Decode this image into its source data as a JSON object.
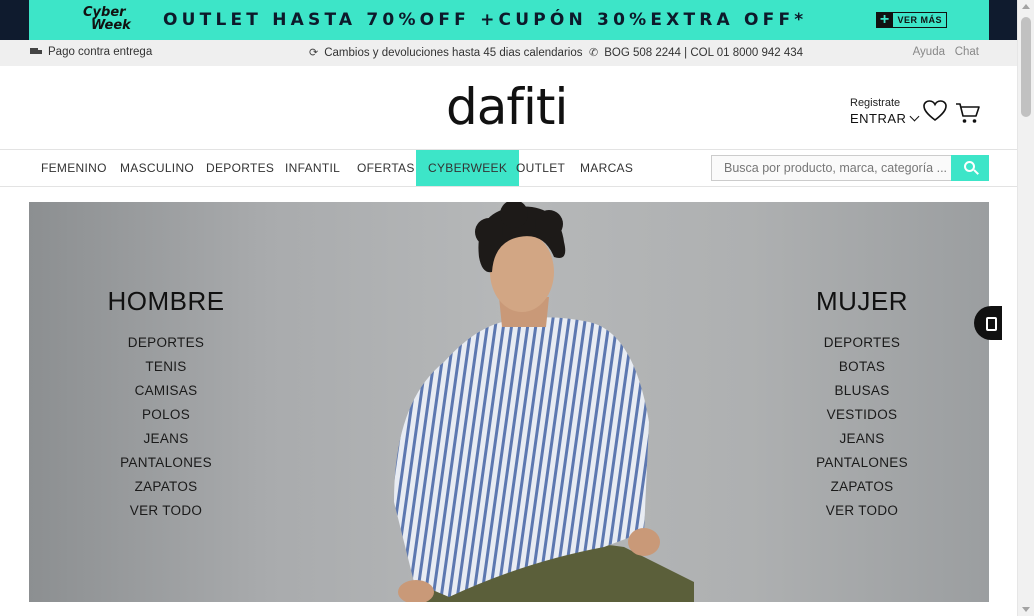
{
  "promo": {
    "logo_line1": "Cyber",
    "logo_line2": "Week",
    "headline": "OUTLET HASTA 70%OFF +CUPÓN 30%EXTRA OFF*",
    "cta": "VER MÁS",
    "bg_color": "#3de5c8"
  },
  "infobar": {
    "delivery": "Pago contra entrega",
    "returns": "Cambios y devoluciones hasta 45 dias calendarios",
    "phone": "BOG 508 2244 | COL 01 8000 942 434",
    "help": "Ayuda",
    "chat": "Chat"
  },
  "header": {
    "logo": "dafiti",
    "register": "Registrate",
    "login": "ENTRAR",
    "wishlist_icon": "heart-icon",
    "cart_icon": "cart-icon"
  },
  "nav": {
    "tabs": [
      "FEMENINO",
      "MASCULINO",
      "DEPORTES",
      "INFANTIL",
      "OFERTAS",
      "CYBERWEEK",
      "OUTLET",
      "MARCAS"
    ],
    "active_tab": "CYBERWEEK",
    "search_placeholder": "Busca por producto, marca, categoría ..."
  },
  "hero": {
    "hombre": {
      "title": "HOMBRE",
      "links": [
        "DEPORTES",
        "TENIS",
        "CAMISAS",
        "POLOS",
        "JEANS",
        "PANTALONES",
        "ZAPATOS",
        "VER TODO"
      ]
    },
    "mujer": {
      "title": "MUJER",
      "links": [
        "DEPORTES",
        "BOTAS",
        "BLUSAS",
        "VESTIDOS",
        "JEANS",
        "PANTALONES",
        "ZAPATOS",
        "VER TODO"
      ]
    }
  }
}
